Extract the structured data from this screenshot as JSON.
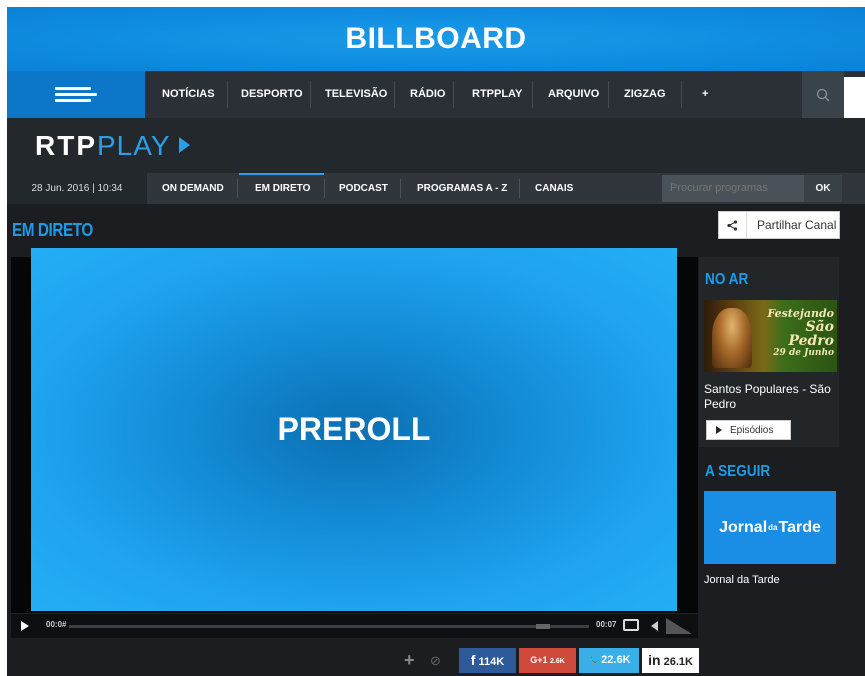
{
  "billboard": {
    "label": "BILLBOARD"
  },
  "topnav": {
    "items": [
      "NOTÍCIAS",
      "DESPORTO",
      "TELEVISÃO",
      "RÁDIO",
      "RTPPLAY",
      "ARQUIVO",
      "ZIGZAG",
      "+"
    ],
    "search_icon": "search-icon"
  },
  "brand": {
    "rtp": "RTP",
    "play": "PLAY"
  },
  "subnav": {
    "date": "28 Jun. 2016 | 10:34",
    "items": [
      "ON DEMAND",
      "EM DIRETO",
      "PODCAST",
      "PROGRAMAS A - Z",
      "CANAIS"
    ],
    "active": "EM DIRETO",
    "search_placeholder": "Procurar programas",
    "ok": "OK"
  },
  "main": {
    "title": "EM DIRETO",
    "share_label": "Partilhar Canal"
  },
  "player": {
    "overlay": "PREROLL",
    "elapsed": "00:0#",
    "remaining": "00:07",
    "progress_fraction": 0.0
  },
  "social": {
    "facebook": "114K",
    "gplus_label": "G+1",
    "gplus_count": "2.6K",
    "twitter": "22.6K",
    "linkedin_label": "in",
    "linkedin": "26.1K"
  },
  "side": {
    "now_title": "NO AR",
    "now_image_text": [
      "Festejando",
      "São Pedro",
      "29 de Junho"
    ],
    "now_show": "Santos Populares - São Pedro",
    "episodes": "Episódios",
    "next_title": "A SEGUIR",
    "next_image_text": {
      "a": "Jornal",
      "b": "da",
      "c": "Tarde"
    },
    "next_show": "Jornal da Tarde"
  },
  "colors": {
    "accent": "#1d9be6",
    "facebook": "#2f5a9a",
    "gplus": "#d04a3c",
    "twitter": "#3aaee8"
  }
}
